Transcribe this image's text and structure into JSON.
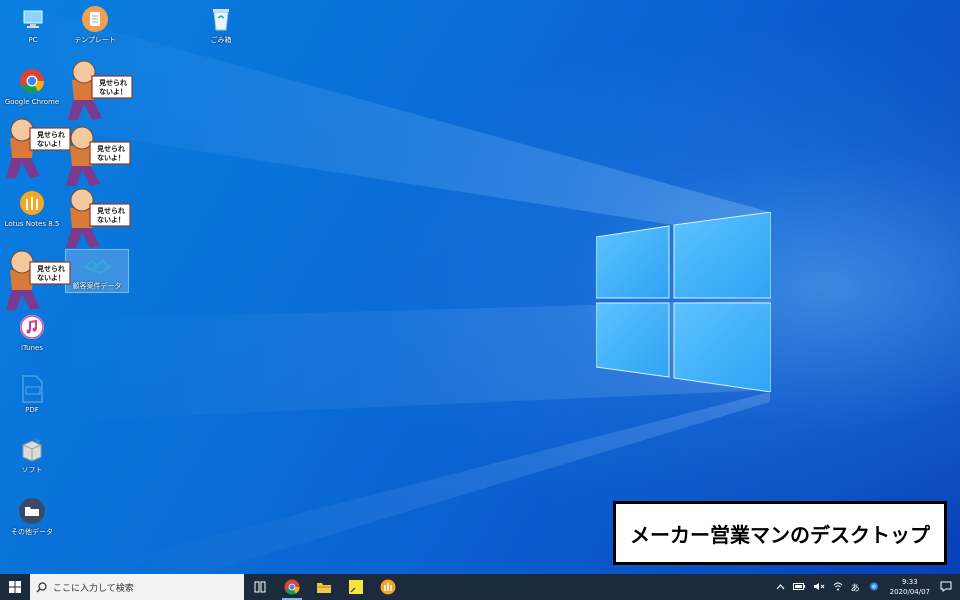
{
  "desktop": {
    "icons": [
      {
        "label": "PC",
        "icon": "pc-icon"
      },
      {
        "label": "テンプレート",
        "icon": "document-icon"
      },
      {
        "label": "ごみ箱",
        "icon": "recycle-bin-icon"
      },
      {
        "label": "Google Chrome",
        "icon": "chrome-icon"
      },
      {
        "label": "Lotus Notes 8.5",
        "icon": "lotus-notes-icon"
      },
      {
        "label": "顧客案件データ",
        "icon": "handshake-icon"
      },
      {
        "label": "iTunes",
        "icon": "itunes-icon"
      },
      {
        "label": "PDF",
        "icon": "pdf-icon"
      },
      {
        "label": "ソフト",
        "icon": "software-icon"
      },
      {
        "label": "その他データ",
        "icon": "folder-icon"
      }
    ],
    "sticker_text_line1": "見せられ",
    "sticker_text_line2": "ないよ！"
  },
  "caption": "メーカー営業マンのデスクトップ",
  "taskbar": {
    "search_placeholder": "ここに入力して検索",
    "apps": [
      "task-view-icon",
      "chrome-icon",
      "file-explorer-icon",
      "sticky-notes-icon",
      "lotus-notes-icon"
    ],
    "ime": "あ",
    "time": "9:33",
    "date": "2020/04/07"
  },
  "colors": {
    "desktop_blue": "#0a6fd8",
    "taskbar": "#1b2a3c"
  }
}
